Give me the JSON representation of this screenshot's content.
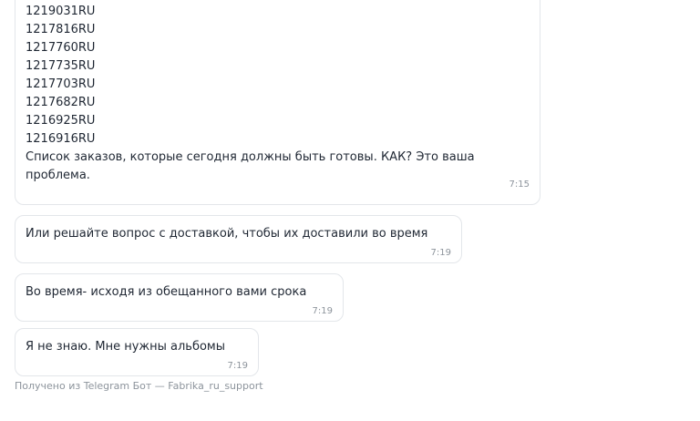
{
  "messages": [
    {
      "lines": [
        "1219031RU",
        "1217816RU",
        "1217760RU",
        "1217735RU",
        "1217703RU",
        "1217682RU",
        "1216925RU",
        "1216916RU"
      ],
      "text": "Список заказов, которые сегодня должны быть готовы. КАК? Это ваша проблема.",
      "time": "7:15"
    },
    {
      "text": "Или решайте вопрос с доставкой, чтобы их доставили во время",
      "time": "7:19"
    },
    {
      "text": "Во время- исходя из обещанного вами срока",
      "time": "7:19"
    },
    {
      "text": "Я не знаю. Мне нужны альбомы",
      "time": "7:19"
    }
  ],
  "footer": {
    "note": "Получено из Telegram Бот — Fabrika_ru_support"
  }
}
